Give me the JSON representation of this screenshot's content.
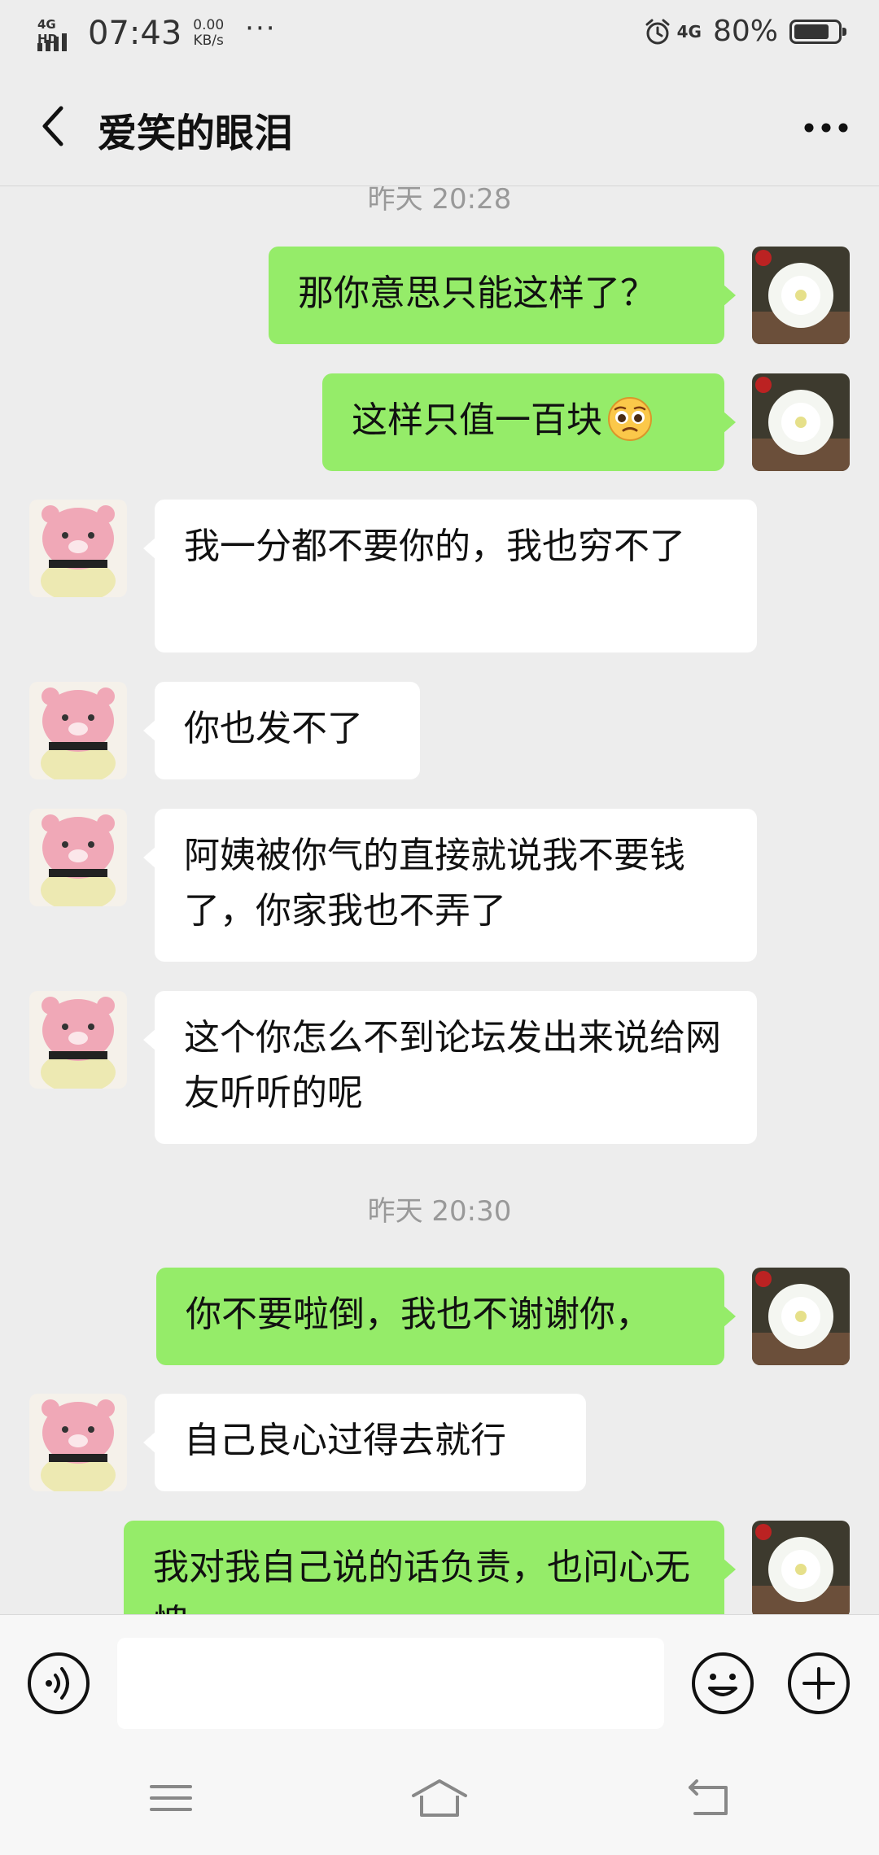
{
  "status_bar": {
    "signal_label": "4G HD",
    "time": "07:43",
    "speed_value": "0.00",
    "speed_unit": "KB/s",
    "dots": "···",
    "network": "4G",
    "battery_percent_text": "80%",
    "battery_level": 0.8
  },
  "header": {
    "title": "爱笑的眼泪",
    "back_icon": "chevron-left-icon",
    "more_icon": "more-dots-icon"
  },
  "messages": {
    "top_timestamp_partial": "昨天 20:28",
    "items": [
      {
        "sender": "me",
        "text": "那你意思只能这样了？"
      },
      {
        "sender": "me",
        "text": "这样只值一百块",
        "emoji": "pleading-face-emoji"
      },
      {
        "sender": "other",
        "text": "我一分都不要你的，我也穷不了"
      },
      {
        "sender": "other",
        "text": "你也发不了"
      },
      {
        "sender": "other",
        "text": "阿姨被你气的直接就说我不要钱了，你家我也不弄了"
      },
      {
        "sender": "other",
        "text": "这个你怎么不到论坛发出来说给网友听听的呢"
      },
      {
        "sender": "me",
        "text": "你不要啦倒，我也不谢谢你，"
      },
      {
        "sender": "other",
        "text": "自己良心过得去就行"
      },
      {
        "sender": "me",
        "text": "我对我自己说的话负责，也问心无愧。"
      }
    ],
    "middle_timestamp": "昨天 20:30"
  },
  "input_bar": {
    "voice_icon": "voice-icon",
    "text_value": "",
    "emoji_icon": "emoji-icon",
    "plus_icon": "plus-icon"
  },
  "system_nav": {
    "menu_icon": "menu-icon",
    "home_icon": "home-icon",
    "back_icon": "back-icon"
  },
  "colors": {
    "background": "#ededed",
    "my_bubble": "#95ec69",
    "other_bubble": "#ffffff",
    "timestamp_text": "#999999"
  }
}
